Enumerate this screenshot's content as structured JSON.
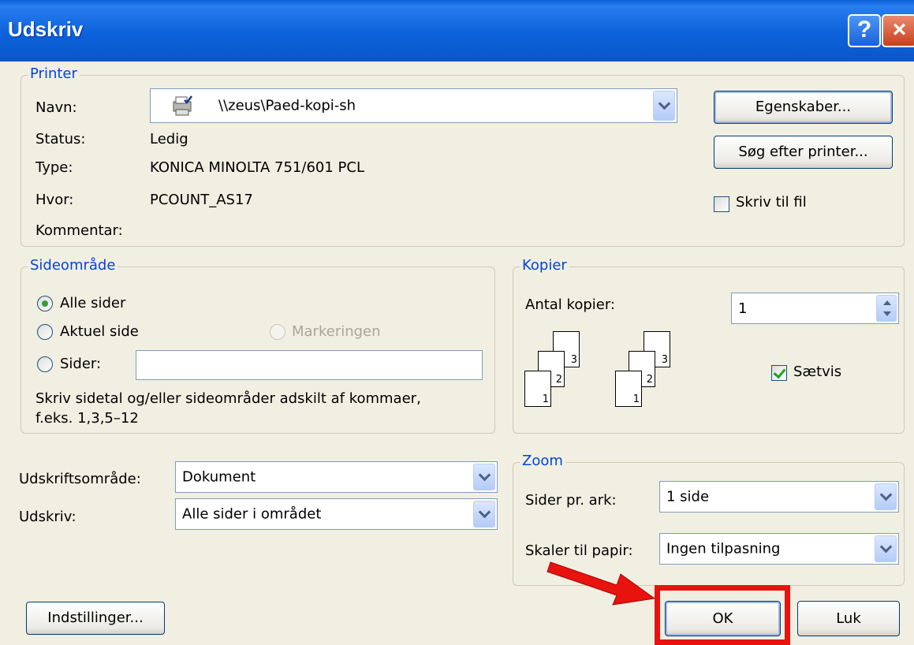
{
  "window": {
    "title": "Udskriv",
    "help_label": "?",
    "close_label": "×"
  },
  "printer": {
    "legend": "Printer",
    "name_label": "Navn:",
    "name_value": "\\\\zeus\\Paed-kopi-sh",
    "status_label": "Status:",
    "status_value": "Ledig",
    "type_label": "Type:",
    "type_value": "KONICA MINOLTA 751/601 PCL",
    "where_label": "Hvor:",
    "where_value": "PCOUNT_AS17",
    "comment_label": "Kommentar:",
    "properties_button": "Egenskaber...",
    "find_printer_button": "Søg efter printer...",
    "print_to_file_label": "Skriv til fil",
    "print_to_file_checked": false
  },
  "page_range": {
    "legend": "Sideområde",
    "all_pages": "Alle sider",
    "current_page": "Aktuel side",
    "selection": "Markeringen",
    "pages": "Sider:",
    "pages_value": "",
    "hint_line1": "Skriv sidetal og/eller sideområder adskilt af kommaer,",
    "hint_line2": "f.eks. 1,3,5–12",
    "selected": "all_pages"
  },
  "copies": {
    "legend": "Kopier",
    "count_label": "Antal kopier:",
    "count_value": "1",
    "collate_label": "Sætvis",
    "collate_checked": true,
    "page_numbers": [
      "1",
      "2",
      "3"
    ]
  },
  "print_what": {
    "area_label": "Udskriftsområde:",
    "area_value": "Dokument",
    "print_label": "Udskriv:",
    "print_value": "Alle sider i området"
  },
  "zoom": {
    "legend": "Zoom",
    "pages_per_sheet_label": "Sider pr. ark:",
    "pages_per_sheet_value": "1 side",
    "scale_label": "Skaler til papir:",
    "scale_value": "Ingen tilpasning"
  },
  "footer": {
    "options_button": "Indstillinger...",
    "ok_button": "OK",
    "close_button": "Luk"
  },
  "annotation": {
    "color": "#e8120f"
  }
}
